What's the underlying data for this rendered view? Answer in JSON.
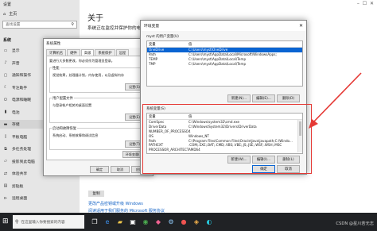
{
  "settings": {
    "window_title": "设置",
    "home_label": "主页",
    "search_placeholder": "查找设置",
    "category": "系统",
    "nav": [
      {
        "label": "显示",
        "icon": "monitor-icon"
      },
      {
        "label": "声音",
        "icon": "speaker-icon"
      },
      {
        "label": "通知和操作",
        "icon": "notification-icon"
      },
      {
        "label": "专注助手",
        "icon": "moon-icon"
      },
      {
        "label": "电源和睡眠",
        "icon": "power-icon"
      },
      {
        "label": "电池",
        "icon": "battery-icon"
      },
      {
        "label": "存储",
        "icon": "storage-icon"
      },
      {
        "label": "平板电脑",
        "icon": "tablet-icon"
      },
      {
        "label": "多任务处理",
        "icon": "multitask-icon"
      },
      {
        "label": "投影到此电脑",
        "icon": "project-icon"
      },
      {
        "label": "体验共享",
        "icon": "share-icon"
      },
      {
        "label": "剪贴板",
        "icon": "clipboard-icon"
      },
      {
        "label": "远程桌面",
        "icon": "remote-icon"
      }
    ],
    "active_index": 6,
    "about_title": "关于",
    "about_subtitle": "系统正在监控并保护你的电脑。",
    "copy_button": "复制",
    "links": [
      "更改产品密钥或升级 Windows",
      "阅读适用于我们服务的 Microsoft 服务协议"
    ]
  },
  "system_properties": {
    "title": "系统属性",
    "tabs": [
      "计算机名",
      "硬件",
      "高级",
      "系统保护",
      "远程"
    ],
    "selected_tab": 2,
    "admin_note": "要进行大多数更改，你必须作为管理员登录。",
    "performance": {
      "title": "性能",
      "text": "视觉效果，处理器计划，内存使用，以及虚拟内存",
      "button": "设置(S)..."
    },
    "user_profiles": {
      "title": "用户配置文件",
      "text": "与登录帐户相关的桌面设置",
      "button": "设置(E)..."
    },
    "startup": {
      "title": "启动和故障恢复",
      "text": "系统启动、系统故障和调试信息",
      "button": "设置(T)..."
    },
    "env_button": "环境变量(N)...",
    "ok": "确定",
    "cancel": "取消",
    "apply": "应用(A)"
  },
  "env_vars": {
    "title": "环境变量",
    "user_section": "myst 的用户变量(U)",
    "col_var": "变量",
    "col_val": "值",
    "user_rows": [
      {
        "name": "OneDrive",
        "value": "C:\\Users\\myst\\OneDrive"
      },
      {
        "name": "Path",
        "value": "C:\\Users\\myst\\AppData\\Local\\Microsoft\\WindowsApps;"
      },
      {
        "name": "TEMP",
        "value": "C:\\Users\\myst\\AppData\\Local\\Temp"
      },
      {
        "name": "TMP",
        "value": "C:\\Users\\myst\\AppData\\Local\\Temp"
      }
    ],
    "user_selected": 0,
    "new_user": "新建(N)...",
    "edit_user": "编辑(E)...",
    "delete_user": "删除(D)",
    "system_section": "系统变量(S)",
    "system_rows": [
      {
        "name": "ComSpec",
        "value": "C:\\Windows\\system32\\cmd.exe"
      },
      {
        "name": "DriverData",
        "value": "C:\\Windows\\System32\\Drivers\\DriverData"
      },
      {
        "name": "NUMBER_OF_PROCESSORS",
        "value": "4"
      },
      {
        "name": "OS",
        "value": "Windows_NT"
      },
      {
        "name": "Path",
        "value": "C:\\Program Files\\Common Files\\Oracle\\Java\\javapath;C:\\Windo..."
      },
      {
        "name": "PATHEXT",
        "value": ".COM;.EXE;.BAT;.CMD;.VBS;.VBE;.JS;.JSE;.WSF;.WSH;.MSC"
      },
      {
        "name": "PROCESSOR_ARCHITECT...",
        "value": "AMD64"
      }
    ],
    "new_sys": "新建(W)...",
    "edit_sys": "编辑(I)...",
    "delete_sys": "删除(L)",
    "ok": "确定",
    "cancel": "取消"
  },
  "taskbar": {
    "search_placeholder": "在这里输入你要搜索的内容",
    "watermark": "CSDN @星川若无志"
  },
  "colors": {
    "highlight": "#e53935",
    "selection": "#0a64d2",
    "link": "#1664c6"
  }
}
